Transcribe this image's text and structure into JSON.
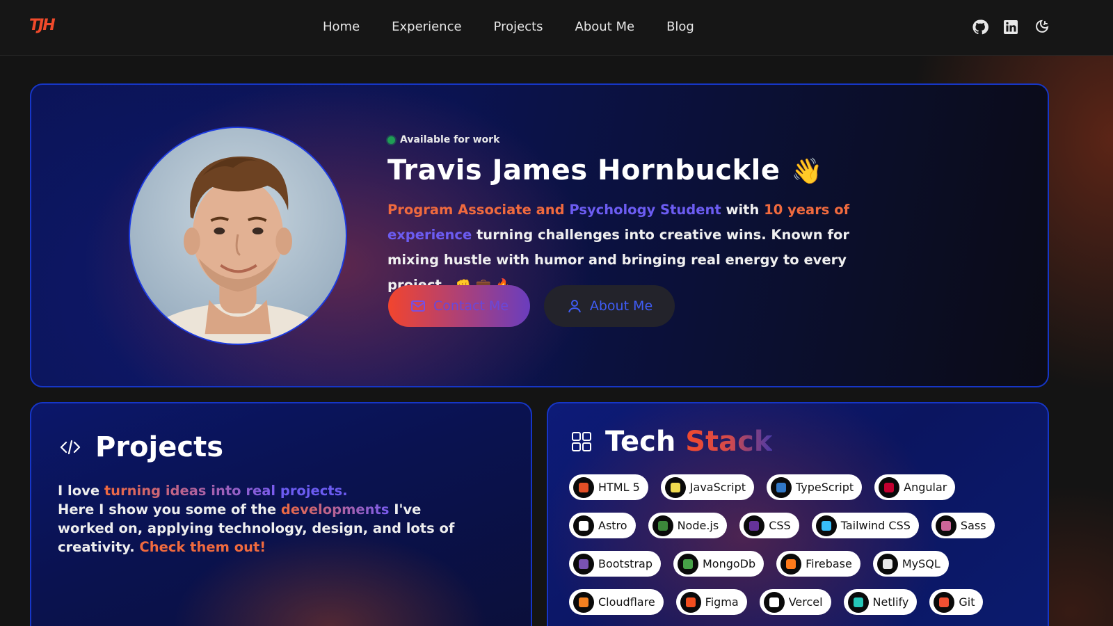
{
  "nav": {
    "logo": "TJH",
    "links": [
      "Home",
      "Experience",
      "Projects",
      "About Me",
      "Blog"
    ],
    "icons": [
      "github-icon",
      "linkedin-icon",
      "theme-toggle-icon"
    ]
  },
  "hero": {
    "status": "Available for work",
    "name": "Travis James Hornbuckle",
    "wave_emoji": "👋",
    "desc": {
      "role_1": "Program Associate and",
      "role_2": "Psychology Student",
      "with": "with",
      "years_1": "10 years of",
      "years_2": "experience",
      "rest": "turning challenges into creative wins. Known for mixing hustle with humor and bringing real energy to every project.",
      "emojis": "👊 💼 🔥"
    },
    "contact_label": "Contact Me",
    "about_label": "About Me"
  },
  "projects": {
    "title": "Projects",
    "p1": "I love",
    "p2": "turning ideas into real",
    "p3": "projects.",
    "p4": "Here I show you some of the",
    "p5": "developments",
    "p6": "I've worked on, applying technology, design, and lots of creativity.",
    "p7": "Check them out!"
  },
  "tech": {
    "title_1": "Tech",
    "title_2": "Stack",
    "rows": [
      [
        {
          "label": "HTML 5",
          "color": "#e34f26"
        },
        {
          "label": "JavaScript",
          "color": "#f0db4f"
        },
        {
          "label": "TypeScript",
          "color": "#3178c6"
        },
        {
          "label": "Angular",
          "color": "#c3002f"
        }
      ],
      [
        {
          "label": "Astro",
          "color": "#ffffff"
        },
        {
          "label": "Node.js",
          "color": "#3c873a"
        },
        {
          "label": "CSS",
          "color": "#663399"
        },
        {
          "label": "Tailwind CSS",
          "color": "#38bdf8"
        },
        {
          "label": "Sass",
          "color": "#cc6699"
        }
      ],
      [
        {
          "label": "Bootstrap",
          "color": "#7952b3"
        },
        {
          "label": "MongoDb",
          "color": "#47a248"
        },
        {
          "label": "Firebase",
          "color": "#ff7a1a"
        },
        {
          "label": "MySQL",
          "color": "#e8e8e8"
        }
      ],
      [
        {
          "label": "Cloudflare",
          "color": "#f38020"
        },
        {
          "label": "Figma",
          "color": "#f24e1e"
        },
        {
          "label": "Vercel",
          "color": "#ffffff"
        },
        {
          "label": "Netlify",
          "color": "#25c7b7"
        },
        {
          "label": "Git",
          "color": "#f05032"
        }
      ]
    ]
  }
}
